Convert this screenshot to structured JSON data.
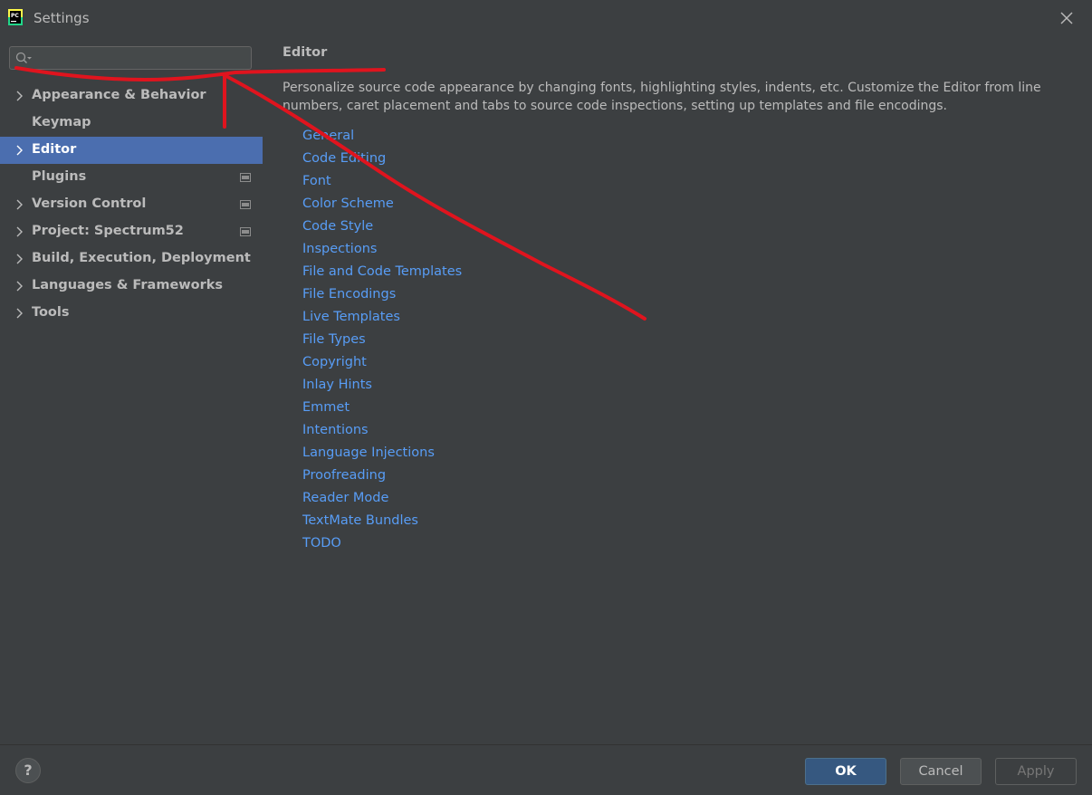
{
  "window": {
    "title": "Settings",
    "app_icon_text": "PC"
  },
  "search": {
    "value": "",
    "placeholder": ""
  },
  "sidebar": {
    "items": [
      {
        "label": "Appearance & Behavior"
      },
      {
        "label": "Keymap"
      },
      {
        "label": "Editor"
      },
      {
        "label": "Plugins"
      },
      {
        "label": "Version Control"
      },
      {
        "label": "Project: Spectrum52"
      },
      {
        "label": "Build, Execution, Deployment"
      },
      {
        "label": "Languages & Frameworks"
      },
      {
        "label": "Tools"
      }
    ]
  },
  "main": {
    "title": "Editor",
    "description": "Personalize source code appearance by changing fonts, highlighting styles, indents, etc. Customize the Editor from line numbers, caret placement and tabs to source code inspections, setting up templates and file encodings.",
    "links": [
      "General",
      "Code Editing",
      "Font",
      "Color Scheme",
      "Code Style",
      "Inspections",
      "File and Code Templates",
      "File Encodings",
      "Live Templates",
      "File Types",
      "Copyright",
      "Inlay Hints",
      "Emmet",
      "Intentions",
      "Language Injections",
      "Proofreading",
      "Reader Mode",
      "TextMate Bundles",
      "TODO"
    ]
  },
  "footer": {
    "help_label": "?",
    "ok_label": "OK",
    "cancel_label": "Cancel",
    "apply_label": "Apply"
  },
  "colors": {
    "background": "#3c3f41",
    "selection": "#4b6eaf",
    "link": "#589df6",
    "primary_button": "#365880",
    "annotation": "#e0141e"
  }
}
